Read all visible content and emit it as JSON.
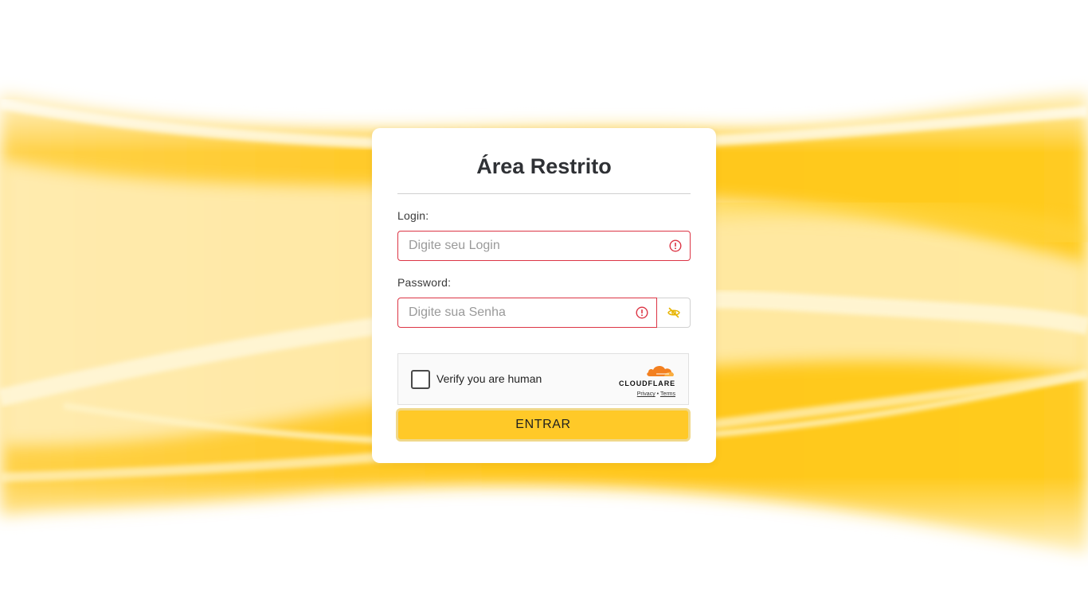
{
  "card": {
    "title": "Área Restrito"
  },
  "login": {
    "label": "Login:",
    "placeholder": "Digite seu Login",
    "value": ""
  },
  "password": {
    "label": "Password:",
    "placeholder": "Digite sua Senha",
    "value": ""
  },
  "captcha": {
    "label": "Verify you are human",
    "brand": "CLOUDFLARE",
    "privacy_link": "Privacy",
    "separator": "•",
    "terms_link": "Terms"
  },
  "submit": {
    "label": "ENTRAR"
  },
  "colors": {
    "accent": "#ffc928",
    "error": "#dc3545",
    "cloudflare_orange": "#f38020"
  },
  "icons": {
    "login_status": "error-circle-icon",
    "password_status": "error-circle-icon",
    "password_toggle": "eye-slash-icon",
    "captcha_brand": "cloudflare-cloud-icon"
  }
}
